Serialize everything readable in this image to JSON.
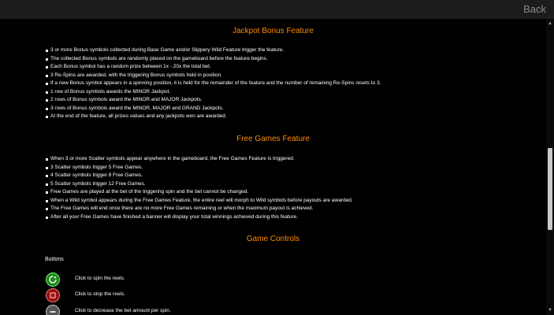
{
  "header": {
    "back_label": "Back"
  },
  "jackpot": {
    "title": "Jackpot Bonus Feature",
    "items": [
      "3 or more Bonus symbols collected during Base Game and/or Slippery Wild Feature trigger the feature.",
      "The collected Bonus symbols are randomly placed on the gameboard before the feature begins.",
      "Each Bonus symbol has a random prize between 1x - 20x the total bet.",
      "3 Re-Spins are awarded, with the triggering Bonus symbols held in position.",
      "If a new Bonus symbol appears in a spinning position, it is held for the remainder of the feature and the number of remaining Re-Spins resets to 3.",
      "1 row of Bonus symbols awards the MINOR Jackpot.",
      "2 rows of Bonus symbols award the MINOR and MAJOR Jackpots.",
      "3 rows of Bonus symbols award the MINOR, MAJOR and GRAND Jackpots.",
      "At the end of the feature, all prizes values and any jackpots won are awarded."
    ]
  },
  "free_games": {
    "title": "Free Games Feature",
    "items": [
      "When 3 or more Scatter symbols appear anywhere in the gameboard, the Free Games Feature is triggered.",
      "3 Scatter symbols trigger 5 Free Games.",
      "4 Scatter symbols trigger 8 Free Games.",
      "5 Scatter symbols trigger 12 Free Games.",
      "Free Games are played at the bet of the triggering spin and the bet cannot be changed.",
      "When a Wild symbol appears during the Free Games Feature, the entire reel will morph to Wild symbols before payouts are awarded.",
      "The Free Games will end once there are no more Free Games remaining or when the maximum payout is achieved.",
      "After all your Free Games have finished a banner will display your total winnings achieved during this feature."
    ]
  },
  "controls": {
    "title": "Game Controls",
    "buttons_label": "Buttons",
    "items": [
      {
        "icon": "spin-icon",
        "text": "Click to spin the reels."
      },
      {
        "icon": "stop-icon",
        "text": "Click to stop the reels."
      },
      {
        "icon": "minus-icon",
        "text": "Click to decrease the bet amount per spin."
      }
    ]
  },
  "colors": {
    "accent": "#ff8c00",
    "background": "#000000",
    "spin": "#1a8a1a",
    "stop": "#9a1010"
  }
}
